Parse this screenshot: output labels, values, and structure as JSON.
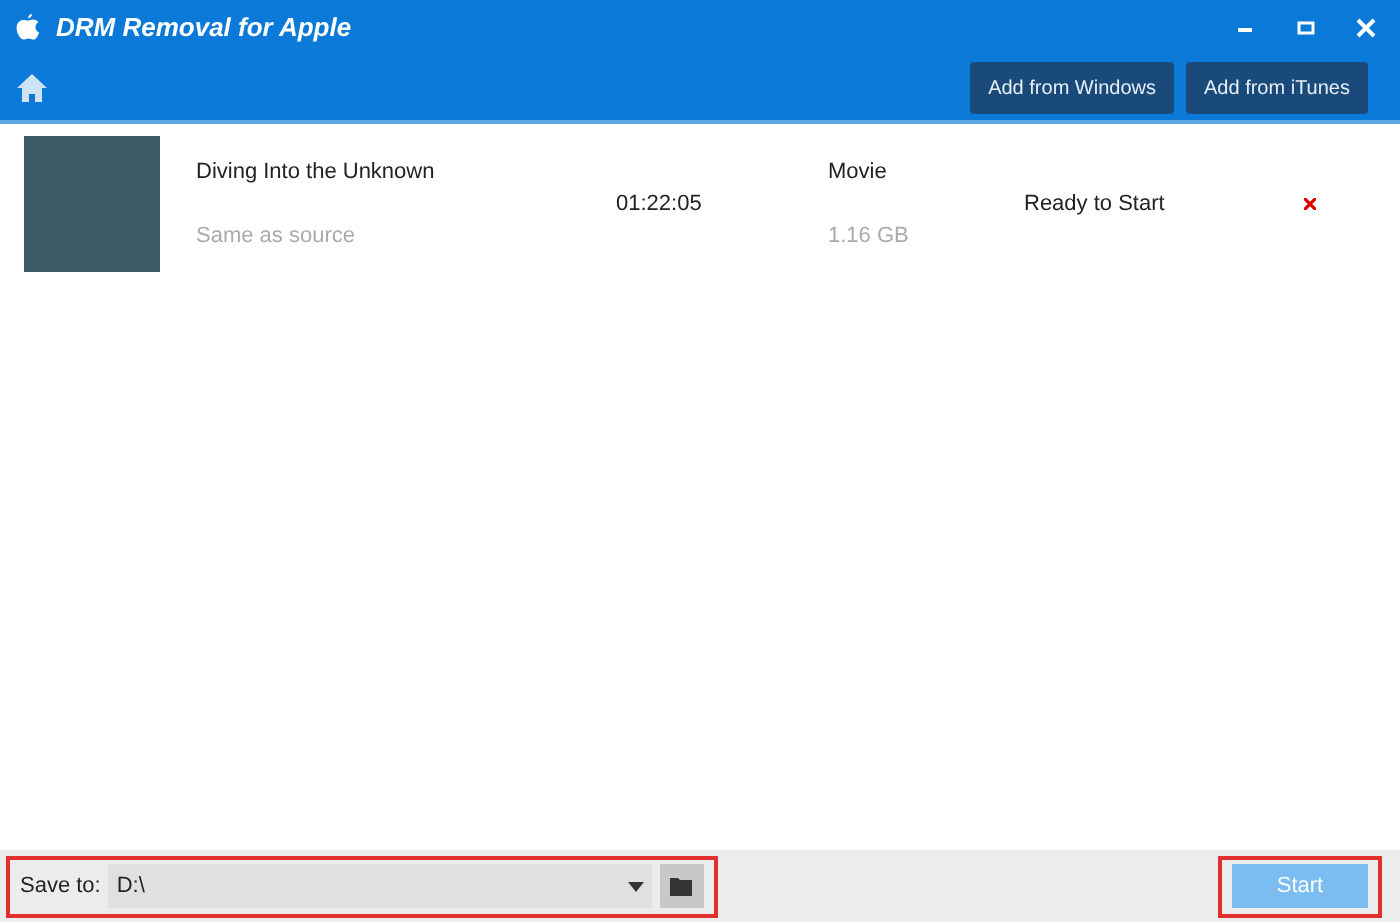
{
  "window": {
    "title": "DRM Removal for Apple"
  },
  "toolbar": {
    "buttons": [
      "Add from Windows",
      "Add from iTunes"
    ]
  },
  "files": [
    {
      "title": "Diving Into the Unknown",
      "output": "Same as source",
      "duration": "01:22:05",
      "type": "Movie",
      "size": "1.16 GB",
      "status": "Ready to Start"
    }
  ],
  "footer": {
    "save_label": "Save to:",
    "save_path": "D:\\",
    "save_highlighted": true,
    "start": {
      "label": "Start",
      "disabled": true,
      "highlighted": true
    }
  }
}
